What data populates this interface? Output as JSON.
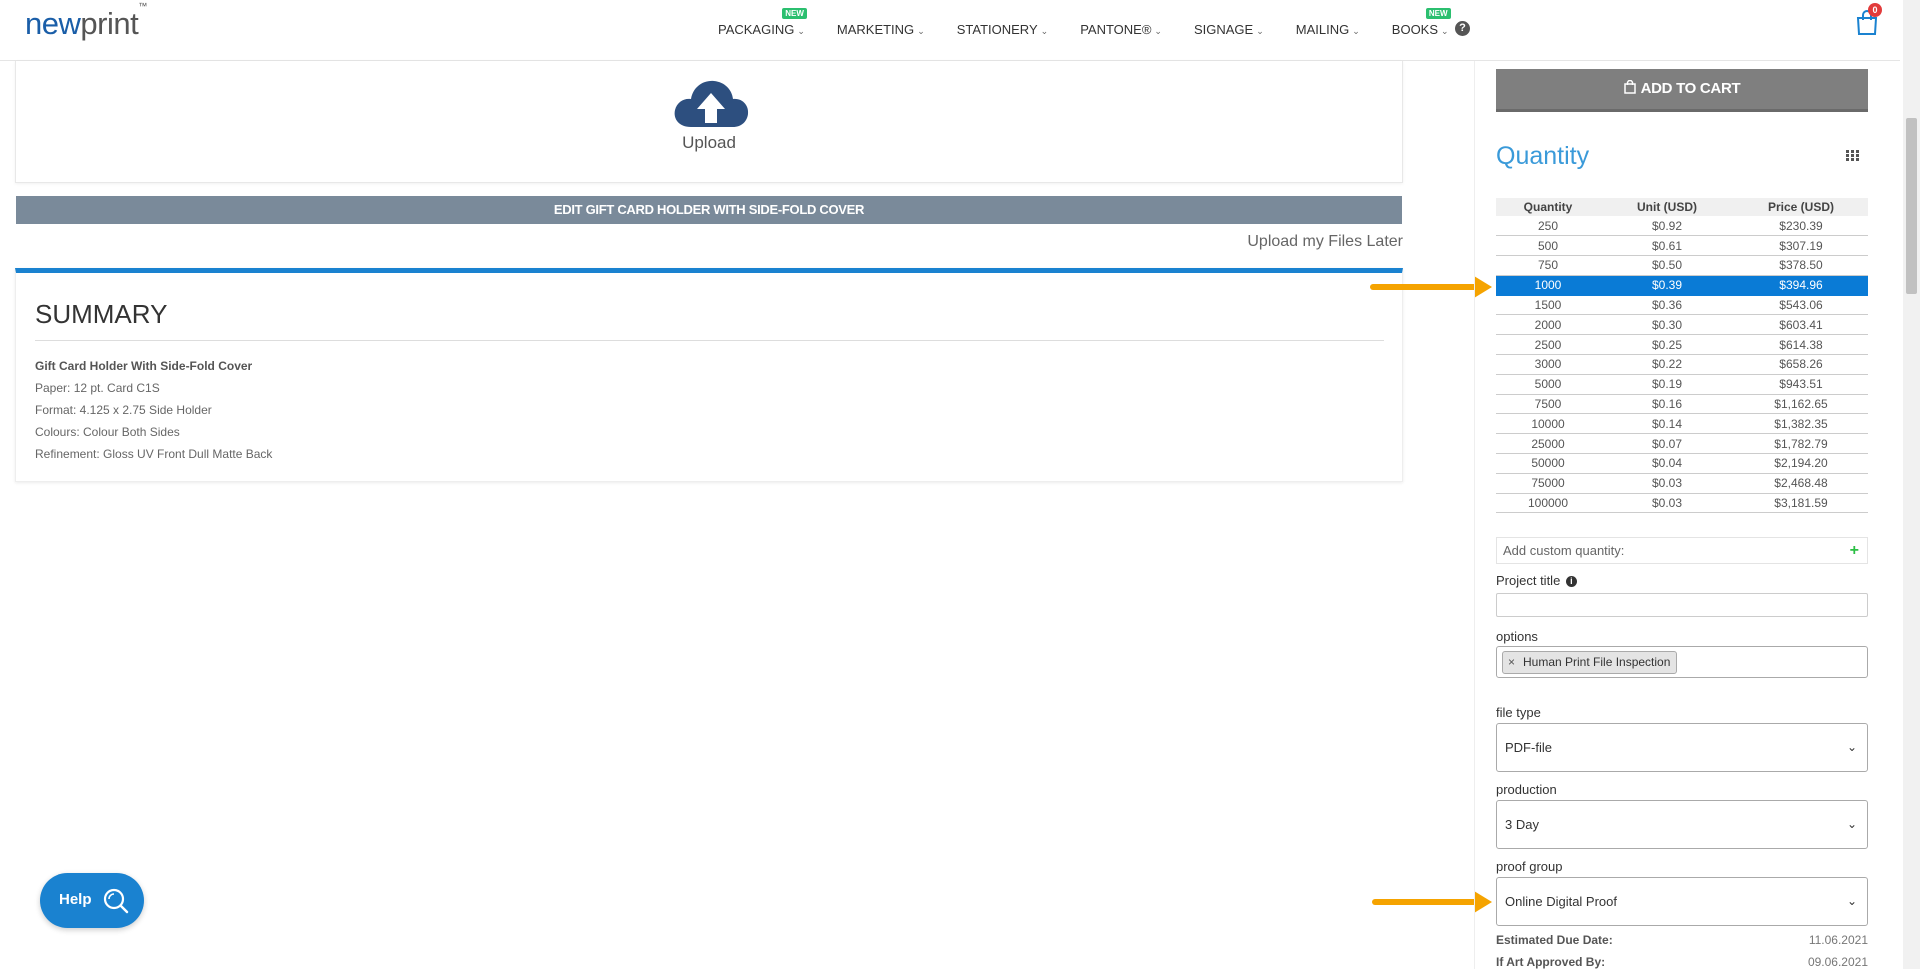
{
  "header": {
    "logo_new": "new",
    "logo_print": "print",
    "logo_tm": "™",
    "nav": [
      {
        "label": "PACKAGING",
        "badge": "NEW"
      },
      {
        "label": "MARKETING",
        "badge": ""
      },
      {
        "label": "STATIONERY",
        "badge": ""
      },
      {
        "label": "PANTONE®",
        "badge": ""
      },
      {
        "label": "SIGNAGE",
        "badge": ""
      },
      {
        "label": "MAILING",
        "badge": ""
      },
      {
        "label": "BOOKS",
        "badge": "NEW"
      }
    ],
    "help_symbol": "?",
    "cart_count": "0"
  },
  "upload": {
    "label": "Upload",
    "edit_button": "EDIT GIFT CARD HOLDER WITH SIDE-FOLD COVER",
    "later_link": "Upload my Files Later"
  },
  "summary": {
    "title": "SUMMARY",
    "product": "Gift Card Holder With Side-Fold Cover",
    "paper": "Paper: 12 pt. Card C1S",
    "format": "Format: 4.125 x 2.75 Side Holder",
    "colours": "Colours: Colour Both Sides",
    "refinement": "Refinement: Gloss UV Front Dull Matte Back"
  },
  "help_button": "Help",
  "right": {
    "add_to_cart": "ADD TO CART",
    "quantity_title": "Quantity",
    "table_headers": [
      "Quantity",
      "Unit (USD)",
      "Price (USD)"
    ],
    "rows": [
      [
        "250",
        "$0.92",
        "$230.39"
      ],
      [
        "500",
        "$0.61",
        "$307.19"
      ],
      [
        "750",
        "$0.50",
        "$378.50"
      ],
      [
        "1000",
        "$0.39",
        "$394.96"
      ],
      [
        "1500",
        "$0.36",
        "$543.06"
      ],
      [
        "2000",
        "$0.30",
        "$603.41"
      ],
      [
        "2500",
        "$0.25",
        "$614.38"
      ],
      [
        "3000",
        "$0.22",
        "$658.26"
      ],
      [
        "5000",
        "$0.19",
        "$943.51"
      ],
      [
        "7500",
        "$0.16",
        "$1,162.65"
      ],
      [
        "10000",
        "$0.14",
        "$1,382.35"
      ],
      [
        "25000",
        "$0.07",
        "$1,782.79"
      ],
      [
        "50000",
        "$0.04",
        "$2,194.20"
      ],
      [
        "75000",
        "$0.03",
        "$2,468.48"
      ],
      [
        "100000",
        "$0.03",
        "$3,181.59"
      ]
    ],
    "selected_row_index": 3,
    "custom_qty_placeholder": "Add custom quantity:",
    "project_title_label": "Project title",
    "options_label": "options",
    "options_tag": "Human Print File Inspection",
    "file_type_label": "file type",
    "file_type_value": "PDF-file",
    "production_label": "production",
    "production_value": "3 Day",
    "proof_group_label": "proof group",
    "proof_group_value": "Online Digital Proof",
    "due_date_label": "Estimated Due Date:",
    "due_date_value": "11.06.2021",
    "approved_label": "If Art Approved By:",
    "approved_value": "09.06.2021"
  },
  "colors": {
    "accent_blue": "#1a82d0",
    "arrow": "#f5a300",
    "selected_row": "#0a7bd6"
  }
}
